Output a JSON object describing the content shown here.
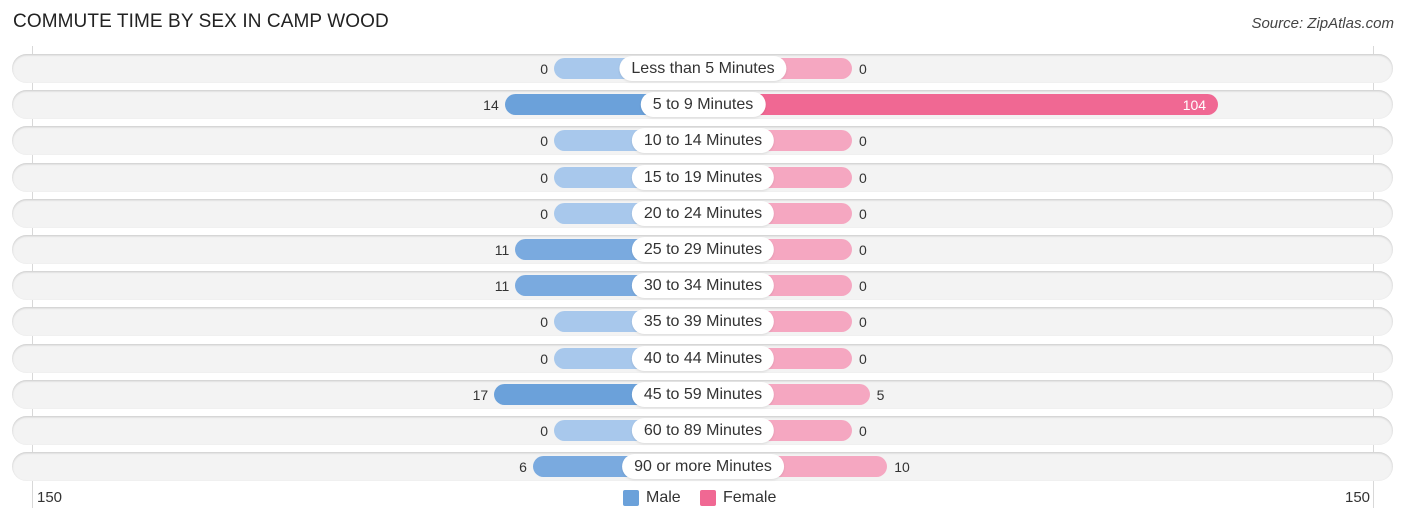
{
  "title": "COMMUTE TIME BY SEX IN CAMP WOOD",
  "source": "Source: ZipAtlas.com",
  "colors": {
    "male": "#6ba1da",
    "male_light": "#a8c8ec",
    "female": "#f06893",
    "female_light": "#f5a7c1"
  },
  "chart_data": {
    "type": "bar",
    "orientation": "horizontal-diverging",
    "title": "COMMUTE TIME BY SEX IN CAMP WOOD",
    "categories": [
      "Less than 5 Minutes",
      "5 to 9 Minutes",
      "10 to 14 Minutes",
      "15 to 19 Minutes",
      "20 to 24 Minutes",
      "25 to 29 Minutes",
      "30 to 34 Minutes",
      "35 to 39 Minutes",
      "40 to 44 Minutes",
      "45 to 59 Minutes",
      "60 to 89 Minutes",
      "90 or more Minutes"
    ],
    "series": [
      {
        "name": "Male",
        "values": [
          0,
          14,
          0,
          0,
          0,
          11,
          11,
          0,
          0,
          17,
          0,
          6
        ]
      },
      {
        "name": "Female",
        "values": [
          0,
          104,
          0,
          0,
          0,
          0,
          0,
          0,
          0,
          5,
          0,
          10
        ]
      }
    ],
    "axis": {
      "left_label": "150",
      "right_label": "150",
      "range": [
        150,
        150
      ]
    },
    "legend": {
      "position": "bottom-center",
      "entries": [
        "Male",
        "Female"
      ]
    }
  }
}
